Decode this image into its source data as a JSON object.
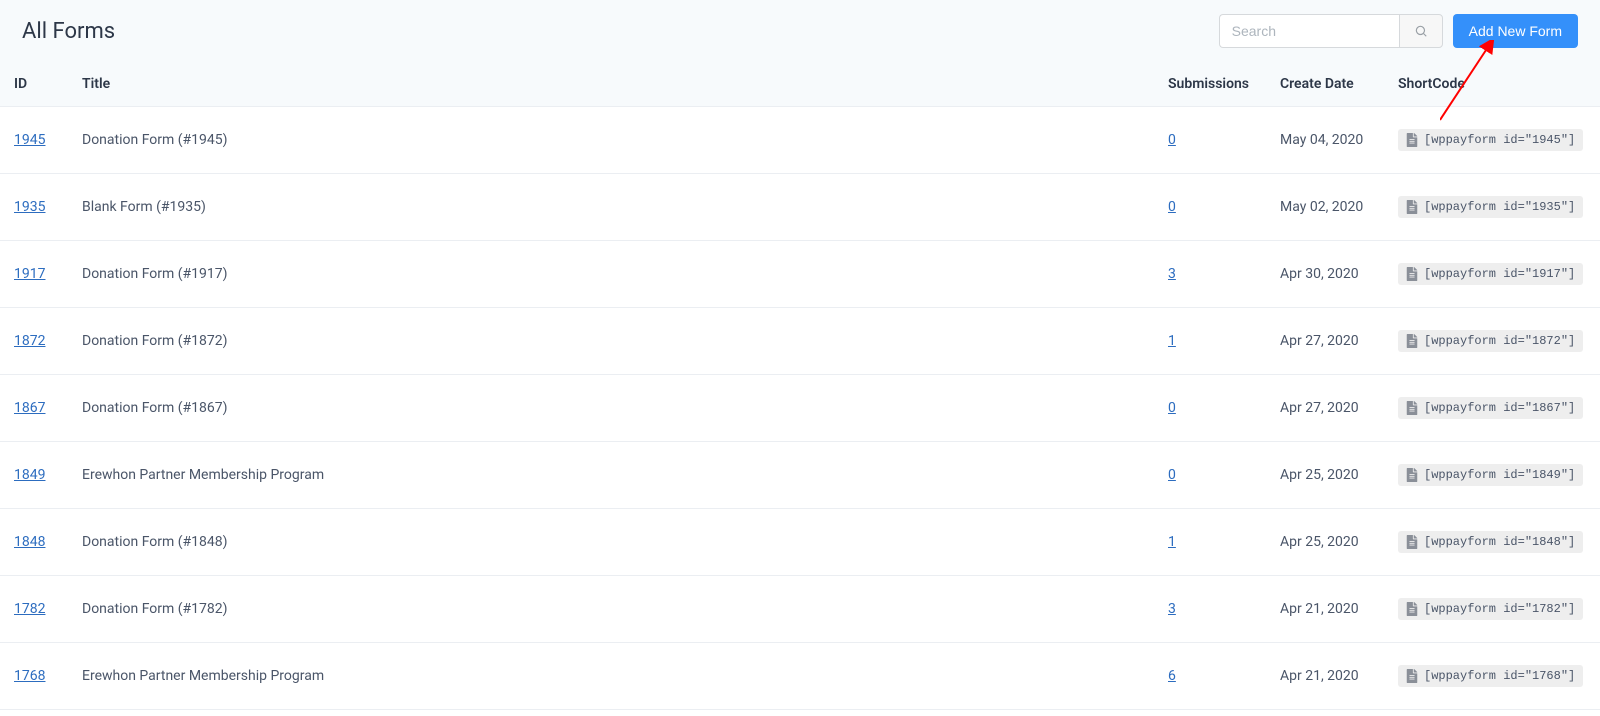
{
  "header": {
    "title": "All Forms",
    "search_placeholder": "Search",
    "add_button_label": "Add New Form"
  },
  "columns": {
    "id": "ID",
    "title": "Title",
    "submissions": "Submissions",
    "create_date": "Create Date",
    "shortcode": "ShortCode"
  },
  "rows": [
    {
      "id": "1945",
      "title": "Donation Form (#1945)",
      "submissions": "0",
      "date": "May 04, 2020",
      "shortcode": "[wppayform id=\"1945\"]"
    },
    {
      "id": "1935",
      "title": "Blank Form (#1935)",
      "submissions": "0",
      "date": "May 02, 2020",
      "shortcode": "[wppayform id=\"1935\"]"
    },
    {
      "id": "1917",
      "title": "Donation Form (#1917)",
      "submissions": "3",
      "date": "Apr 30, 2020",
      "shortcode": "[wppayform id=\"1917\"]"
    },
    {
      "id": "1872",
      "title": "Donation Form (#1872)",
      "submissions": "1",
      "date": "Apr 27, 2020",
      "shortcode": "[wppayform id=\"1872\"]"
    },
    {
      "id": "1867",
      "title": "Donation Form (#1867)",
      "submissions": "0",
      "date": "Apr 27, 2020",
      "shortcode": "[wppayform id=\"1867\"]"
    },
    {
      "id": "1849",
      "title": "Erewhon Partner Membership Program",
      "submissions": "0",
      "date": "Apr 25, 2020",
      "shortcode": "[wppayform id=\"1849\"]"
    },
    {
      "id": "1848",
      "title": "Donation Form (#1848)",
      "submissions": "1",
      "date": "Apr 25, 2020",
      "shortcode": "[wppayform id=\"1848\"]"
    },
    {
      "id": "1782",
      "title": "Donation Form (#1782)",
      "submissions": "3",
      "date": "Apr 21, 2020",
      "shortcode": "[wppayform id=\"1782\"]"
    },
    {
      "id": "1768",
      "title": "Erewhon Partner Membership Program",
      "submissions": "6",
      "date": "Apr 21, 2020",
      "shortcode": "[wppayform id=\"1768\"]"
    }
  ]
}
